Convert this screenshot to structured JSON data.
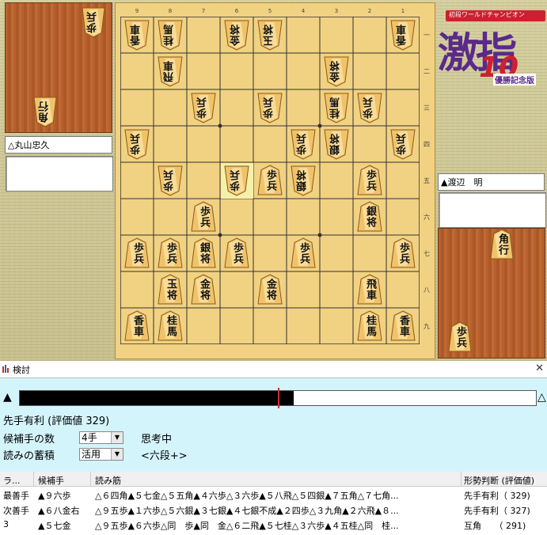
{
  "players": {
    "gote_name": "△丸山忠久",
    "sente_name": "▲渡辺　明"
  },
  "logo": {
    "subtitle": "初段ワールドチャンピオン",
    "main": "激指",
    "number": "10",
    "edition": "優勝記念版",
    "colors": {
      "main": "#5a2a8a",
      "accent": "#cc2030"
    }
  },
  "board": {
    "files": [
      "9",
      "8",
      "7",
      "6",
      "5",
      "4",
      "3",
      "2",
      "1"
    ],
    "ranks": [
      "一",
      "二",
      "三",
      "四",
      "五",
      "六",
      "七",
      "八",
      "九"
    ],
    "pieces": [
      {
        "f": 9,
        "r": 1,
        "t": "香車",
        "o": "g"
      },
      {
        "f": 8,
        "r": 1,
        "t": "桂馬",
        "o": "g"
      },
      {
        "f": 6,
        "r": 1,
        "t": "金将",
        "o": "g"
      },
      {
        "f": 5,
        "r": 1,
        "t": "玉将",
        "o": "g"
      },
      {
        "f": 1,
        "r": 1,
        "t": "香車",
        "o": "g"
      },
      {
        "f": 8,
        "r": 2,
        "t": "飛車",
        "o": "g"
      },
      {
        "f": 3,
        "r": 2,
        "t": "金将",
        "o": "g"
      },
      {
        "f": 7,
        "r": 3,
        "t": "歩兵",
        "o": "g"
      },
      {
        "f": 5,
        "r": 3,
        "t": "歩兵",
        "o": "g"
      },
      {
        "f": 3,
        "r": 3,
        "t": "桂馬",
        "o": "g"
      },
      {
        "f": 2,
        "r": 3,
        "t": "歩兵",
        "o": "g"
      },
      {
        "f": 9,
        "r": 4,
        "t": "歩兵",
        "o": "g"
      },
      {
        "f": 4,
        "r": 4,
        "t": "歩兵",
        "o": "g"
      },
      {
        "f": 3,
        "r": 4,
        "t": "銀将",
        "o": "g"
      },
      {
        "f": 1,
        "r": 4,
        "t": "歩兵",
        "o": "g"
      },
      {
        "f": 8,
        "r": 5,
        "t": "歩兵",
        "o": "g"
      },
      {
        "f": 6,
        "r": 5,
        "t": "歩兵",
        "o": "g",
        "hl": true
      },
      {
        "f": 5,
        "r": 5,
        "t": "歩兵",
        "o": "s"
      },
      {
        "f": 4,
        "r": 5,
        "t": "銀将",
        "o": "g"
      },
      {
        "f": 2,
        "r": 5,
        "t": "歩兵",
        "o": "s"
      },
      {
        "f": 7,
        "r": 6,
        "t": "歩兵",
        "o": "s"
      },
      {
        "f": 2,
        "r": 6,
        "t": "銀将",
        "o": "s"
      },
      {
        "f": 9,
        "r": 7,
        "t": "歩兵",
        "o": "s"
      },
      {
        "f": 8,
        "r": 7,
        "t": "歩兵",
        "o": "s"
      },
      {
        "f": 7,
        "r": 7,
        "t": "銀将",
        "o": "s"
      },
      {
        "f": 6,
        "r": 7,
        "t": "歩兵",
        "o": "s"
      },
      {
        "f": 4,
        "r": 7,
        "t": "歩兵",
        "o": "s"
      },
      {
        "f": 1,
        "r": 7,
        "t": "歩兵",
        "o": "s"
      },
      {
        "f": 8,
        "r": 8,
        "t": "玉将",
        "o": "s"
      },
      {
        "f": 7,
        "r": 8,
        "t": "金将",
        "o": "s"
      },
      {
        "f": 5,
        "r": 8,
        "t": "金将",
        "o": "s"
      },
      {
        "f": 2,
        "r": 8,
        "t": "飛車",
        "o": "s"
      },
      {
        "f": 9,
        "r": 9,
        "t": "香車",
        "o": "s"
      },
      {
        "f": 8,
        "r": 9,
        "t": "桂馬",
        "o": "s"
      },
      {
        "f": 2,
        "r": 9,
        "t": "桂馬",
        "o": "s"
      },
      {
        "f": 1,
        "r": 9,
        "t": "香車",
        "o": "s"
      }
    ],
    "colors": {
      "board": "#f1d282",
      "line": "#333333",
      "highlight": "#f6f0a8"
    }
  },
  "hands": {
    "gote": [
      {
        "t": "歩兵"
      },
      {
        "t": "角行"
      }
    ],
    "sente": [
      {
        "t": "角行"
      },
      {
        "t": "歩兵"
      }
    ]
  },
  "dialog": {
    "title": "検討",
    "close": "✕",
    "bar_left": "▲",
    "bar_right": "△",
    "eval_fraction": 0.53,
    "status": "先手有利 (評価値 329)",
    "candidates_label": "候補手の数",
    "candidates_value": "4手",
    "thinking": "思考中",
    "accum_label": "読みの蓄積",
    "accum_value": "活用",
    "level": "<六段+>",
    "columns": [
      "ラ...",
      "候補手",
      "読み筋",
      "形勢判断 (評価値)"
    ],
    "rows": [
      {
        "rank": "最善手",
        "move": "▲９六歩",
        "pv": "△６四角▲５七金△５五角▲４六歩△３六歩▲５八飛△５四銀▲７五角△７七角...",
        "judge": "先手有利（  329)"
      },
      {
        "rank": "次善手",
        "move": "▲６八金右",
        "pv": "△９五歩▲１六歩△５六銀▲３七銀▲４七銀不成▲２四歩△３九角▲２六飛▲８...",
        "judge": "先手有利（  327)"
      },
      {
        "rank": "3",
        "move": "▲５七金",
        "pv": "△９五歩▲６六歩△同　歩▲同　金△６二飛▲５七桂△３六歩▲４五桂△同　桂...",
        "judge": "互角　　（  291)"
      }
    ]
  }
}
